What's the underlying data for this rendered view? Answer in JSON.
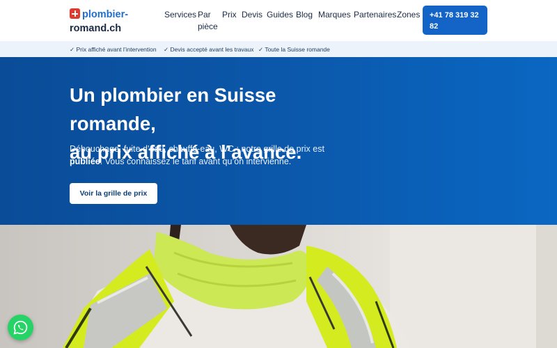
{
  "header": {
    "logo_part1": "plombier-",
    "logo_part2": "romand.ch",
    "nav": {
      "services": "Services",
      "par_piece": "Par pièce",
      "prix": "Prix",
      "devis": "Devis",
      "guides": "Guides",
      "blog": "Blog",
      "marques": "Marques",
      "partenaires": "Partenaires",
      "zones": "Zones"
    },
    "phone": "+41 78 319 32 82"
  },
  "trust_bar": [
    "✓ Prix affiché avant l’intervention",
    "✓ Devis accepté avant les travaux",
    "✓ Toute la Suisse romande"
  ],
  "hero": {
    "title_line1": "Un plombier en Suisse romande,",
    "title_line2": "au prix affiché à l’avance.",
    "subtitle_before": "Débouchage, fuite d’eau, chauffe-eau, WC : notre grille de prix est ",
    "subtitle_bold": "publiée",
    "subtitle_after": ". Vous connaissez le tarif avant qu’on intervienne.",
    "cta": "Voir la grille de prix"
  },
  "icons": {
    "logo": "swiss-cross-icon",
    "whatsapp": "whatsapp-icon"
  },
  "colors": {
    "primary": "#1464c8",
    "hero_bg": "#0b56a8",
    "logo_red": "#e03a2f",
    "whatsapp": "#25d366"
  }
}
